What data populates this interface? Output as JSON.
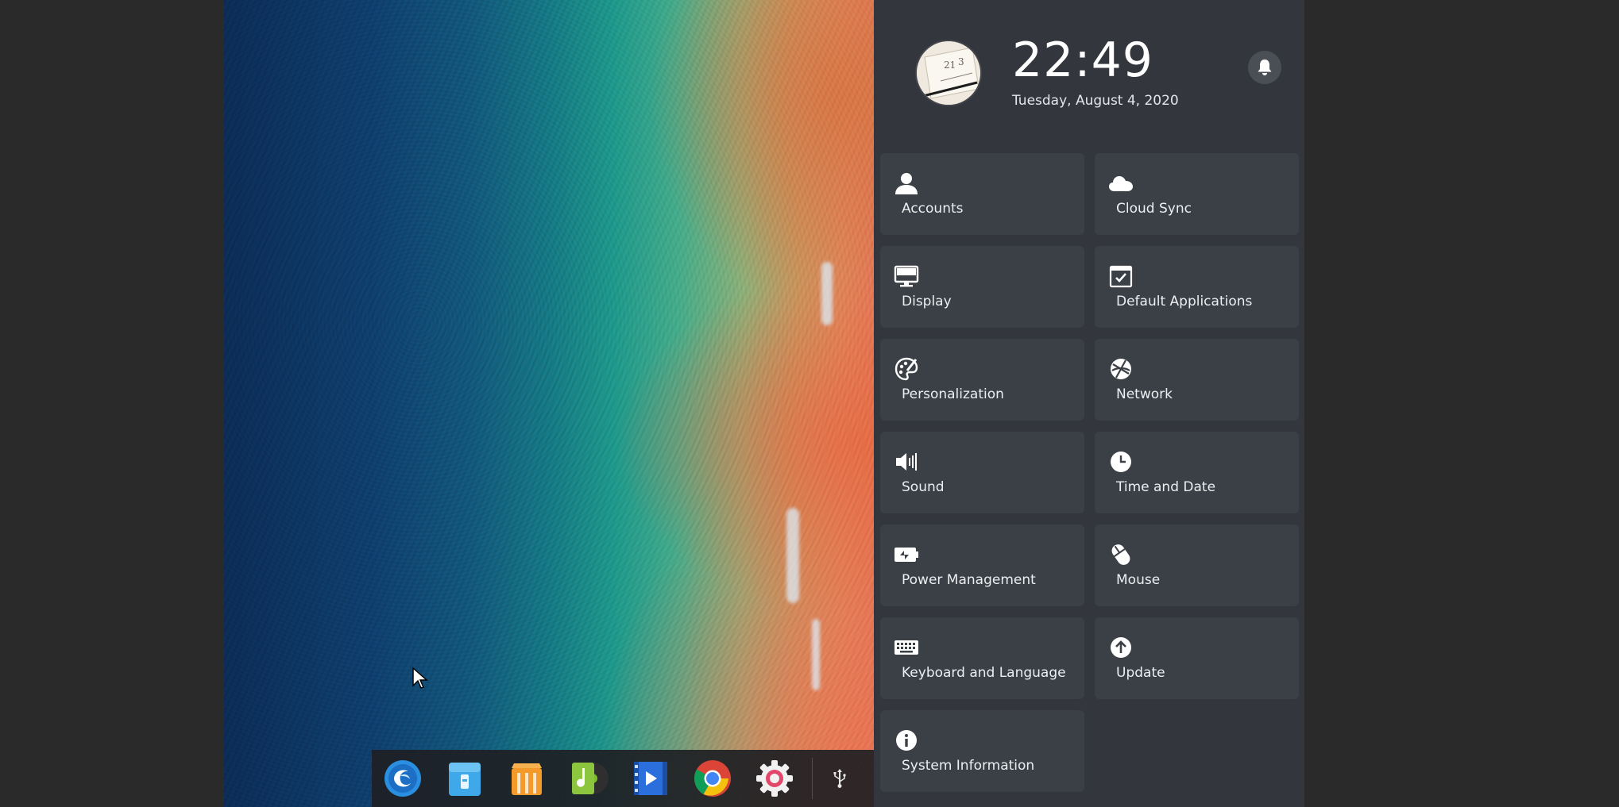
{
  "clock": {
    "time": "22:49",
    "date": "Tuesday, August 4, 2020"
  },
  "notifications": {
    "icon": "bell-icon"
  },
  "control_center": {
    "tiles": [
      {
        "label": "Accounts",
        "icon": "user-icon"
      },
      {
        "label": "Cloud Sync",
        "icon": "cloud-icon"
      },
      {
        "label": "Display",
        "icon": "monitor-icon"
      },
      {
        "label": "Default Applications",
        "icon": "default-apps-icon"
      },
      {
        "label": "Personalization",
        "icon": "palette-icon"
      },
      {
        "label": "Network",
        "icon": "network-globe-icon"
      },
      {
        "label": "Sound",
        "icon": "speaker-icon"
      },
      {
        "label": "Time and Date",
        "icon": "clock-icon"
      },
      {
        "label": "Power Management",
        "icon": "battery-icon"
      },
      {
        "label": "Mouse",
        "icon": "mouse-icon"
      },
      {
        "label": "Keyboard and Language",
        "icon": "keyboard-icon"
      },
      {
        "label": "Update",
        "icon": "update-arrow-icon"
      },
      {
        "label": "System Information",
        "icon": "info-icon"
      }
    ]
  },
  "dock": {
    "apps": [
      {
        "name": "launcher",
        "icon": "deepin-launcher-icon"
      },
      {
        "name": "file-manager",
        "icon": "file-manager-icon"
      },
      {
        "name": "app-store",
        "icon": "app-store-icon"
      },
      {
        "name": "music",
        "icon": "music-icon"
      },
      {
        "name": "movie",
        "icon": "movie-icon"
      },
      {
        "name": "chrome",
        "icon": "chrome-icon"
      },
      {
        "name": "control-center",
        "icon": "settings-gear-icon"
      }
    ],
    "tray": [
      {
        "name": "usb",
        "icon": "usb-icon"
      }
    ]
  },
  "colors": {
    "panel_bg": "#33373d",
    "tile_bg": "#3b4047",
    "dock_bg": "#1e2024"
  }
}
